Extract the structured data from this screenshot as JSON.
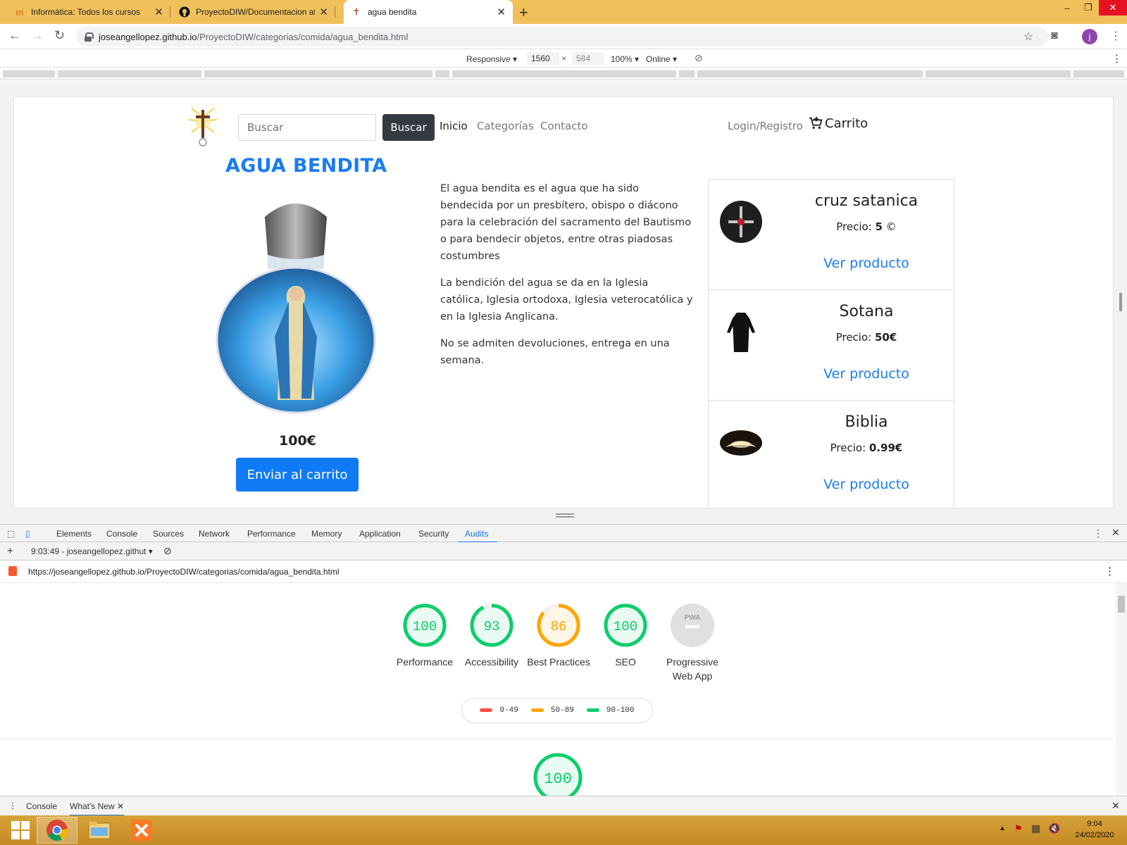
{
  "browser": {
    "tabs": [
      {
        "label": "Informática: Todos los cursos",
        "icon": "moodle-icon"
      },
      {
        "label": "ProyectoDIW/Documentacion at",
        "icon": "github-icon"
      },
      {
        "label": "agua bendita",
        "icon": "cross-favicon"
      }
    ],
    "url_host": "joseangellopez.github.io",
    "url_path": "/ProyectoDIW/categorias/comida/agua_bendita.html",
    "profile_initial": "j"
  },
  "device_toolbar": {
    "mode": "Responsive",
    "width": "1560",
    "height": "584",
    "zoom": "100%",
    "network": "Online"
  },
  "site": {
    "search_placeholder": "Buscar",
    "search_button": "Buscar",
    "nav": [
      "Inicio",
      "Categorías",
      "Contacto"
    ],
    "login": "Login/Registro",
    "cart": "Carrito",
    "title": "AGUA BENDITA",
    "price": "100€",
    "add_to_cart": "Enviar al carrito",
    "description": [
      "El agua bendita es el agua que ha sido bendecida por un presbítero, obispo o diácono para la celebración del sacramento del Bautismo o para bendecir objetos, entre otras piadosas costumbres",
      "La bendición del agua se da en la Iglesia católica, Iglesia ortodoxa, Iglesia veterocatólica y en la Iglesia Anglicana.",
      "No se admiten devoluciones, entrega en una semana."
    ],
    "products": [
      {
        "name": "cruz satanica",
        "price_label": "Precio:",
        "price": "5",
        "link": "Ver producto"
      },
      {
        "name": "Sotana",
        "price_label": "Precio:",
        "price": "50€",
        "link": "Ver producto"
      },
      {
        "name": "Biblia",
        "price_label": "Precio:",
        "price": "0.99€",
        "link": "Ver producto"
      }
    ]
  },
  "devtools": {
    "tabs": [
      "Elements",
      "Console",
      "Sources",
      "Network",
      "Performance",
      "Memory",
      "Application",
      "Security",
      "Audits"
    ],
    "active_tab": "Audits",
    "report_select": "9:03:49 - joseangellopez.githut",
    "report_url": "https://joseangellopez.github.io/ProyectoDIW/categorias/comida/agua_bendita.html",
    "scores": [
      {
        "label": "Performance",
        "value": 100,
        "color": "#0cce6b"
      },
      {
        "label": "Accessibility",
        "value": 93,
        "color": "#0cce6b"
      },
      {
        "label": "Best Practices",
        "value": 86,
        "color": "#ffa400"
      },
      {
        "label": "SEO",
        "value": 100,
        "color": "#0cce6b"
      },
      {
        "label": "Progressive Web App",
        "value": null,
        "color": "#bdbdbd",
        "badge": "PWA"
      }
    ],
    "legend": [
      {
        "range": "0-49",
        "color": "#ff4e42"
      },
      {
        "range": "50-89",
        "color": "#ffa400"
      },
      {
        "range": "90-100",
        "color": "#0cce6b"
      }
    ],
    "bottom_score": 100,
    "drawer_tabs": [
      "Console",
      "What's New"
    ]
  },
  "taskbar": {
    "time": "9:04",
    "date": "24/02/2020"
  }
}
